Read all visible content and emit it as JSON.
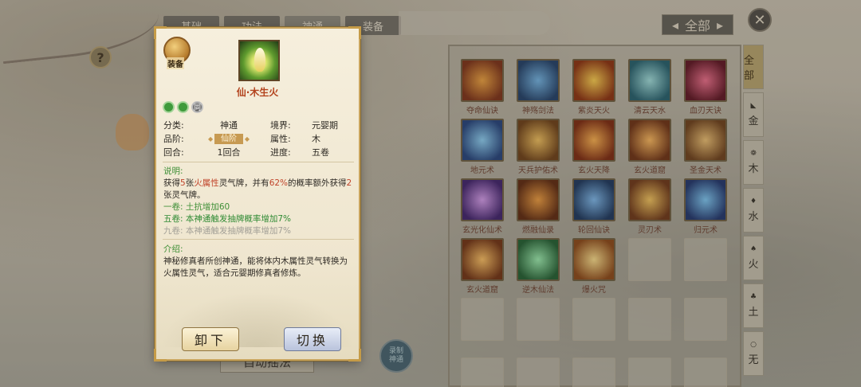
{
  "top_tabs": [
    "基础",
    "功法",
    "神通",
    "装备"
  ],
  "filter_all": {
    "label": "全部",
    "left_arrow": "◂",
    "right_arrow": "▸"
  },
  "help_symbol": "?",
  "close_symbol": "✕",
  "bottom_background_button": "自动摇法",
  "round_badge": [
    "录制",
    "神通"
  ],
  "side_tabs": [
    {
      "label": "全部",
      "symbol": "",
      "active": true
    },
    {
      "label": "金",
      "symbol": "◣"
    },
    {
      "label": "木",
      "symbol": "❁"
    },
    {
      "label": "水",
      "symbol": "♦"
    },
    {
      "label": "火",
      "symbol": "♠"
    },
    {
      "label": "土",
      "symbol": "♣"
    },
    {
      "label": "无",
      "symbol": "○"
    }
  ],
  "skills": [
    {
      "name": "夺命仙诀",
      "colors": [
        "#f0a03a",
        "#7a2a10"
      ]
    },
    {
      "name": "神殇剑法",
      "colors": [
        "#6fb4e8",
        "#1a3a66"
      ]
    },
    {
      "name": "紫炎天火",
      "colors": [
        "#ffcf4a",
        "#8a2a08"
      ]
    },
    {
      "name": "清云天水",
      "colors": [
        "#9fe0e0",
        "#1c5a6a"
      ]
    },
    {
      "name": "血刃天诀",
      "colors": [
        "#f06a8a",
        "#5a0c1c"
      ]
    },
    {
      "name": "地元术",
      "colors": [
        "#8ad0f8",
        "#1c3c7a"
      ]
    },
    {
      "name": "天兵护佑术",
      "colors": [
        "#f4c05a",
        "#6a3a10"
      ]
    },
    {
      "name": "玄火天降",
      "colors": [
        "#ffb04a",
        "#7a2208"
      ]
    },
    {
      "name": "玄火道窟",
      "colors": [
        "#ffb85a",
        "#6a2a0c"
      ]
    },
    {
      "name": "圣金天术",
      "colors": [
        "#f0c070",
        "#6a3a14"
      ]
    },
    {
      "name": "玄光化仙术",
      "colors": [
        "#d69af0",
        "#3a1a6a"
      ]
    },
    {
      "name": "燃融仙录",
      "colors": [
        "#f09a3a",
        "#5a2208"
      ]
    },
    {
      "name": "轮回仙诀",
      "colors": [
        "#7ab8f0",
        "#14305a"
      ]
    },
    {
      "name": "灵刃术",
      "colors": [
        "#f6c45a",
        "#6a3010"
      ]
    },
    {
      "name": "归元术",
      "colors": [
        "#7ac8f8",
        "#182e6a"
      ]
    },
    {
      "name": "玄火道窟",
      "colors": [
        "#ffc060",
        "#6e2c0c"
      ]
    },
    {
      "name": "逆木仙法",
      "colors": [
        "#9af0b0",
        "#1a5a2c"
      ]
    },
    {
      "name": "爆火咒",
      "colors": [
        "#ffe08a",
        "#8a4210"
      ]
    }
  ],
  "empty_cells": 12,
  "popup": {
    "equip_label": "装备",
    "skill_title": "仙·木生火",
    "tong_label": "同",
    "props": {
      "category_key": "分类:",
      "category_val": "神通",
      "realm_key": "境界:",
      "realm_val": "元婴期",
      "rank_key": "品阶:",
      "rank_val": "仙阶",
      "attr_key": "属性:",
      "attr_val": "木",
      "round_key": "回合:",
      "round_val": "1回合",
      "progress_key": "进度:",
      "progress_val": "五卷"
    },
    "desc_title": "说明:",
    "desc_pre": "获得",
    "desc_num1": "5",
    "desc_mid1": "张",
    "desc_fire": "火属性",
    "desc_mid2": "灵气牌，并有",
    "desc_pct": "62%",
    "desc_mid3": "的概率额外获得",
    "desc_num2": "2",
    "desc_end": "张灵气牌。",
    "vol1": "一卷: 土抗增加60",
    "vol5": "五卷: 本神通触发抽牌概率增加7%",
    "vol9": "九卷: 本神通触发抽牌概率增加7%",
    "intro_title": "介绍:",
    "intro_text": "神秘修真者所创神通，能将体内木属性灵气转换为火属性灵气，适合元婴期修真者修炼。",
    "unequip_label": "卸下",
    "switch_label": "切换"
  }
}
